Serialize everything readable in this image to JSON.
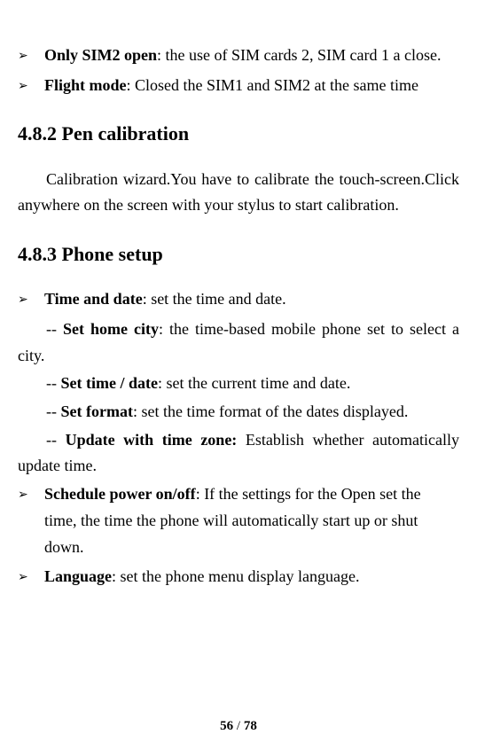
{
  "bullets_top": [
    {
      "marker": "➢",
      "bold": "Only SIM2 open",
      "rest": ": the use of SIM cards 2, SIM card 1 a close."
    },
    {
      "marker": "➢",
      "bold": "Flight mode",
      "rest": ":   Closed the SIM1 and SIM2 at the same time"
    }
  ],
  "section1": {
    "heading": "4.8.2 Pen calibration",
    "para": "Calibration wizard.You have to calibrate the touch-screen.Click anywhere on the screen with your stylus to start calibration."
  },
  "section2": {
    "heading": "4.8.3 Phone setup",
    "bullet1": {
      "marker": "➢",
      "bold": "Time and date",
      "rest": ": set the time and date."
    },
    "subs": [
      {
        "prefix": "-- ",
        "bold": "Set home city",
        "rest": ": the time-based mobile phone set to select a city."
      },
      {
        "prefix": "-- ",
        "bold": "Set time / date",
        "rest": ": set the current time and date."
      },
      {
        "prefix": "-- ",
        "bold": "Set format",
        "rest": ": set the time format of the dates displayed."
      },
      {
        "prefix": "-- ",
        "bold": "Update with time zone: ",
        "rest": "Establish whether automatically update time."
      }
    ],
    "bullet2": {
      "marker": "➢",
      "bold": "Schedule power on/off",
      "rest": ": If the settings for the Open set the time, the time the phone will automatically start up or shut down."
    },
    "bullet3": {
      "marker": "➢",
      "bold": "Language",
      "rest": ": set the phone menu display language."
    }
  },
  "footer": {
    "page": "56",
    "sep": " / ",
    "total": "78"
  }
}
